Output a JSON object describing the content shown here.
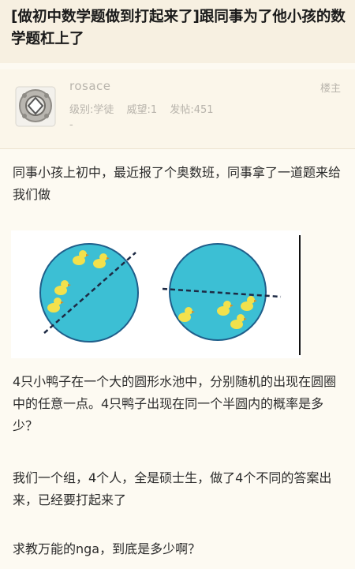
{
  "post": {
    "title": "[做初中数学题做到打起来了]跟同事为了他小孩的数学题杠上了"
  },
  "author": {
    "username": "rosace",
    "floor_tag": "楼主",
    "level": "级别:学徒",
    "prestige": "威望:1",
    "posts": "发帖:451",
    "dash": "-"
  },
  "content": {
    "p1": "同事小孩上初中，最近报了个奥数班，同事拿了一道题来给我们做",
    "p2": "4只小鸭子在一个大的圆形水池中，分别随机的出现在圆圈中的任意一点。4只鸭子出现在同一个半圆内的概率是多少？",
    "p3": "我们一个组，4个人，全是硕士生，做了4个不同的答案出来，已经要打起来了",
    "p4": "求教万能的nga，到底是多少啊？"
  },
  "colors": {
    "pool": "#3cbfd4",
    "pool_border": "#1f5e8a",
    "duck": "#f2e14c"
  }
}
